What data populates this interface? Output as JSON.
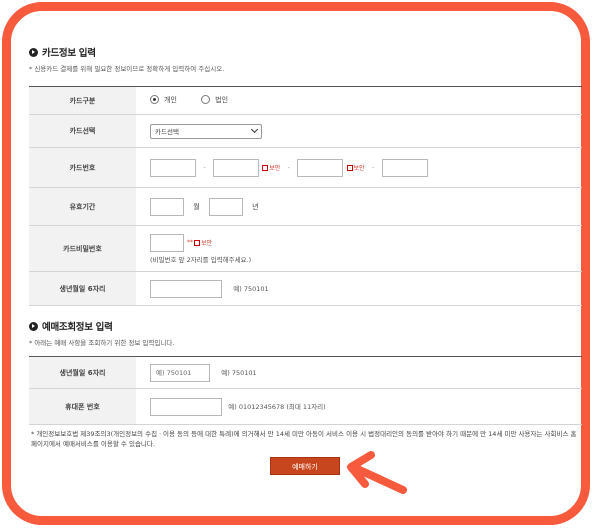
{
  "card_section": {
    "title": "카드정보 입력",
    "desc": "* 신용카드 결제를 위해 필요한 정보이므로 정확하게 입력하여 주십시오.",
    "rows": {
      "card_type": {
        "label": "카드구분",
        "options": [
          "개인",
          "법인"
        ],
        "selected": "개인"
      },
      "card_select": {
        "label": "카드선택",
        "value": "카드선택"
      },
      "card_number": {
        "label": "카드번호",
        "dash": "-",
        "hide_label": "보안"
      },
      "expiry": {
        "label": "유효기간",
        "month_unit": "월",
        "year_unit": "년"
      },
      "password": {
        "label": "카드비밀번호",
        "suffix": "**",
        "hide_label": "보안",
        "hint": "(비밀번호 앞 2자리를 입력해주세요.)"
      },
      "birth": {
        "label": "생년월일 6자리",
        "example": "예) 750101"
      }
    }
  },
  "lookup_section": {
    "title": "예매조회정보 입력",
    "desc": "* 아래는 예매 사항을 조회하기 위한 정보 입력입니다.",
    "rows": {
      "birth": {
        "label": "생년월일 6자리",
        "value": "예) 750101",
        "example": "예) 750101"
      },
      "phone": {
        "label": "휴대폰 번호",
        "example": "예) 01012345678 (최대 11자리)"
      }
    }
  },
  "notice": "* 개인정보보호법 제39조의3(개인정보의 수집ㆍ이용 동의 등에 대한 특례)에 의거해서 만 14세 미만 아동이 서비스 이용 시 법정대리인의 동의를 받아야 하기 때문에 만 14세 미만 사용자는 사회비스 홈페이지에서 예매서비스를 이용할 수 있습니다.",
  "button": {
    "label": "예매하기"
  },
  "colors": {
    "frame": "#f75a3c",
    "button": "#c8461d",
    "arrow": "#f75a3c"
  }
}
